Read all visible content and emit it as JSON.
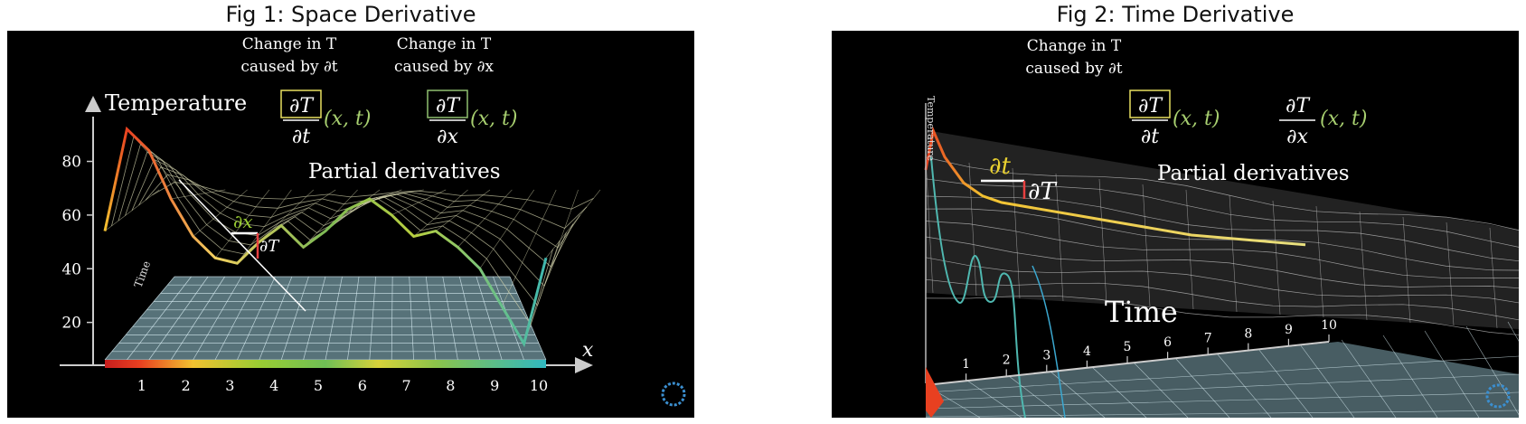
{
  "figures": [
    {
      "title": "Fig 1: Space Derivative",
      "caption_left": [
        "Change in T",
        "caused by ∂t"
      ],
      "caption_right": [
        "Change in T",
        "caused by ∂x"
      ],
      "formula_left": {
        "num": "∂T",
        "den": "∂t",
        "args": "(x, t)"
      },
      "formula_right": {
        "num": "∂T",
        "den": "∂x",
        "args": "(x, t)"
      },
      "heading": "Partial derivatives",
      "z_axis_label": "Temperature",
      "x_axis_label": "x",
      "time_label": "Time",
      "dx_label": "∂x",
      "dT_label": "∂T"
    },
    {
      "title": "Fig 2: Time Derivative",
      "caption_left": [
        "Change in T",
        "caused by ∂t"
      ],
      "formula_left": {
        "num": "∂T",
        "den": "∂t",
        "args": "(x, t)"
      },
      "formula_right": {
        "num": "∂T",
        "den": "∂x",
        "args": "(x, t)"
      },
      "heading": "Partial derivatives",
      "z_axis_label": "Temperature",
      "time_label": "Time",
      "dt_label": "∂t",
      "dT_label": "∂T"
    }
  ],
  "chart_data": [
    {
      "type": "line",
      "title": "Fig 1: Space Derivative",
      "ylabel": "Temperature",
      "xlabel": "x",
      "y_ticks": [
        20,
        40,
        60,
        80
      ],
      "x_ticks": [
        1,
        2,
        3,
        4,
        5,
        6,
        7,
        8,
        9,
        10
      ],
      "xlim": [
        0,
        10
      ],
      "ylim": [
        0,
        95
      ],
      "series": [
        {
          "x": [
            0,
            0.5,
            1,
            1.5,
            2,
            2.5,
            3,
            3.5,
            4,
            4.5,
            5,
            5.5,
            6,
            6.5,
            7,
            7.5,
            8,
            8.5,
            9,
            9.5,
            10
          ],
          "y": [
            50,
            88,
            80,
            62,
            48,
            40,
            38,
            46,
            52,
            44,
            50,
            58,
            62,
            56,
            48,
            50,
            44,
            36,
            22,
            8,
            40
          ]
        }
      ],
      "colors": {
        "hot": "#e02a1c",
        "warm": "#f2c230",
        "mid": "#9acd32",
        "cool": "#3cb4b4"
      }
    },
    {
      "type": "line",
      "title": "Fig 2: Time Derivative",
      "ylabel": "Temperature",
      "xlabel": "Time",
      "x_ticks": [
        1,
        2,
        3,
        4,
        5,
        6,
        7,
        8,
        9,
        10
      ],
      "xlim": [
        0,
        10
      ],
      "series": [
        {
          "x": [
            0,
            0.2,
            0.5,
            1,
            1.5,
            2,
            3,
            4,
            5,
            6,
            7,
            8,
            9,
            10
          ],
          "y": [
            80,
            92,
            84,
            76,
            72,
            70,
            68,
            66,
            64,
            62,
            60,
            59,
            58,
            57
          ]
        }
      ]
    }
  ]
}
